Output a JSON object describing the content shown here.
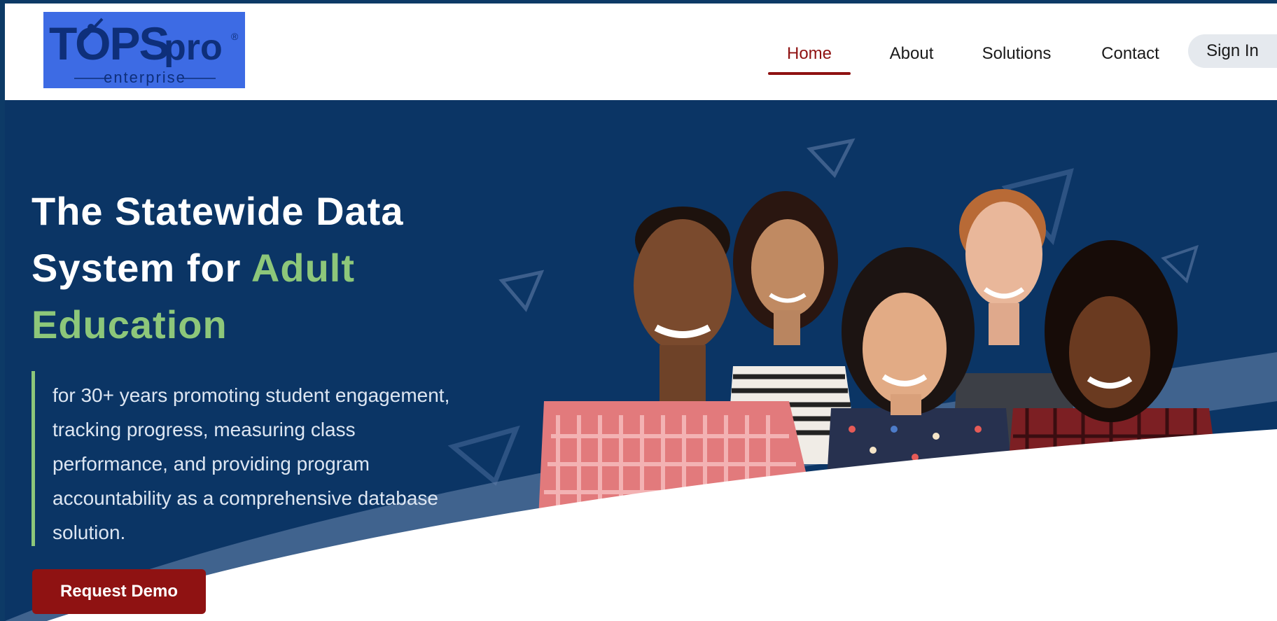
{
  "header": {
    "logo": {
      "text": "TOPSpro",
      "sub": "enterprise",
      "registered": "®"
    },
    "nav": {
      "home": "Home",
      "about": "About",
      "solutions": "Solutions",
      "contact": "Contact",
      "signin": "Sign In"
    }
  },
  "hero": {
    "headline_part1": "The Statewide Data System for ",
    "headline_accent": "Adult Education",
    "tagline": "for 30+ years promoting student engagement, tracking progress, measuring class performance, and providing program accountability as a comprehensive database solution.",
    "cta_label": "Request Demo"
  },
  "colors": {
    "frame": "#0d3a66",
    "hero_bg": "#0b3565",
    "accent_green": "#8dc77a",
    "brand_red": "#8f1212",
    "logo_blue": "#3d6be4"
  }
}
